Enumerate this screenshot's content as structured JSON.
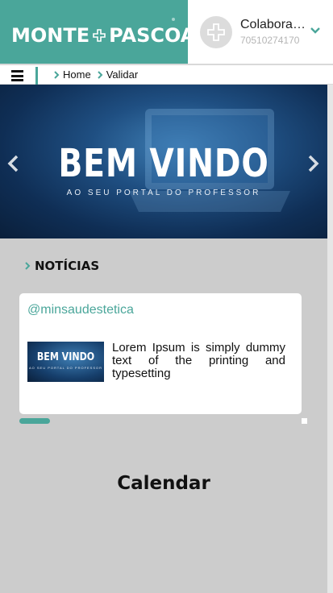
{
  "header": {
    "brand_left": "MONTE",
    "brand_right": "PASCOAL",
    "brand_color": "#4aa69a",
    "user_name": "Colaborad…",
    "user_id": "70510274170",
    "avatar_icon": "cross-emblem-icon",
    "menu_icon": "chevron-down-icon"
  },
  "breadcrumb": {
    "items": [
      {
        "label": "Home"
      },
      {
        "label": "Validar"
      }
    ]
  },
  "hero": {
    "title": "BEM VINDO",
    "subtitle": "AO SEU PORTAL DO PROFESSOR"
  },
  "news": {
    "heading": "NOTÍCIAS",
    "card": {
      "handle": "@minsaudestetica",
      "thumb_title": "BEM VINDO",
      "thumb_subtitle": "AO SEU PORTAL DO PROFESSOR",
      "text": "Lorem Ipsum is simply dummy text of the printing and typesetting"
    }
  },
  "calendar": {
    "title": "Calendar"
  }
}
